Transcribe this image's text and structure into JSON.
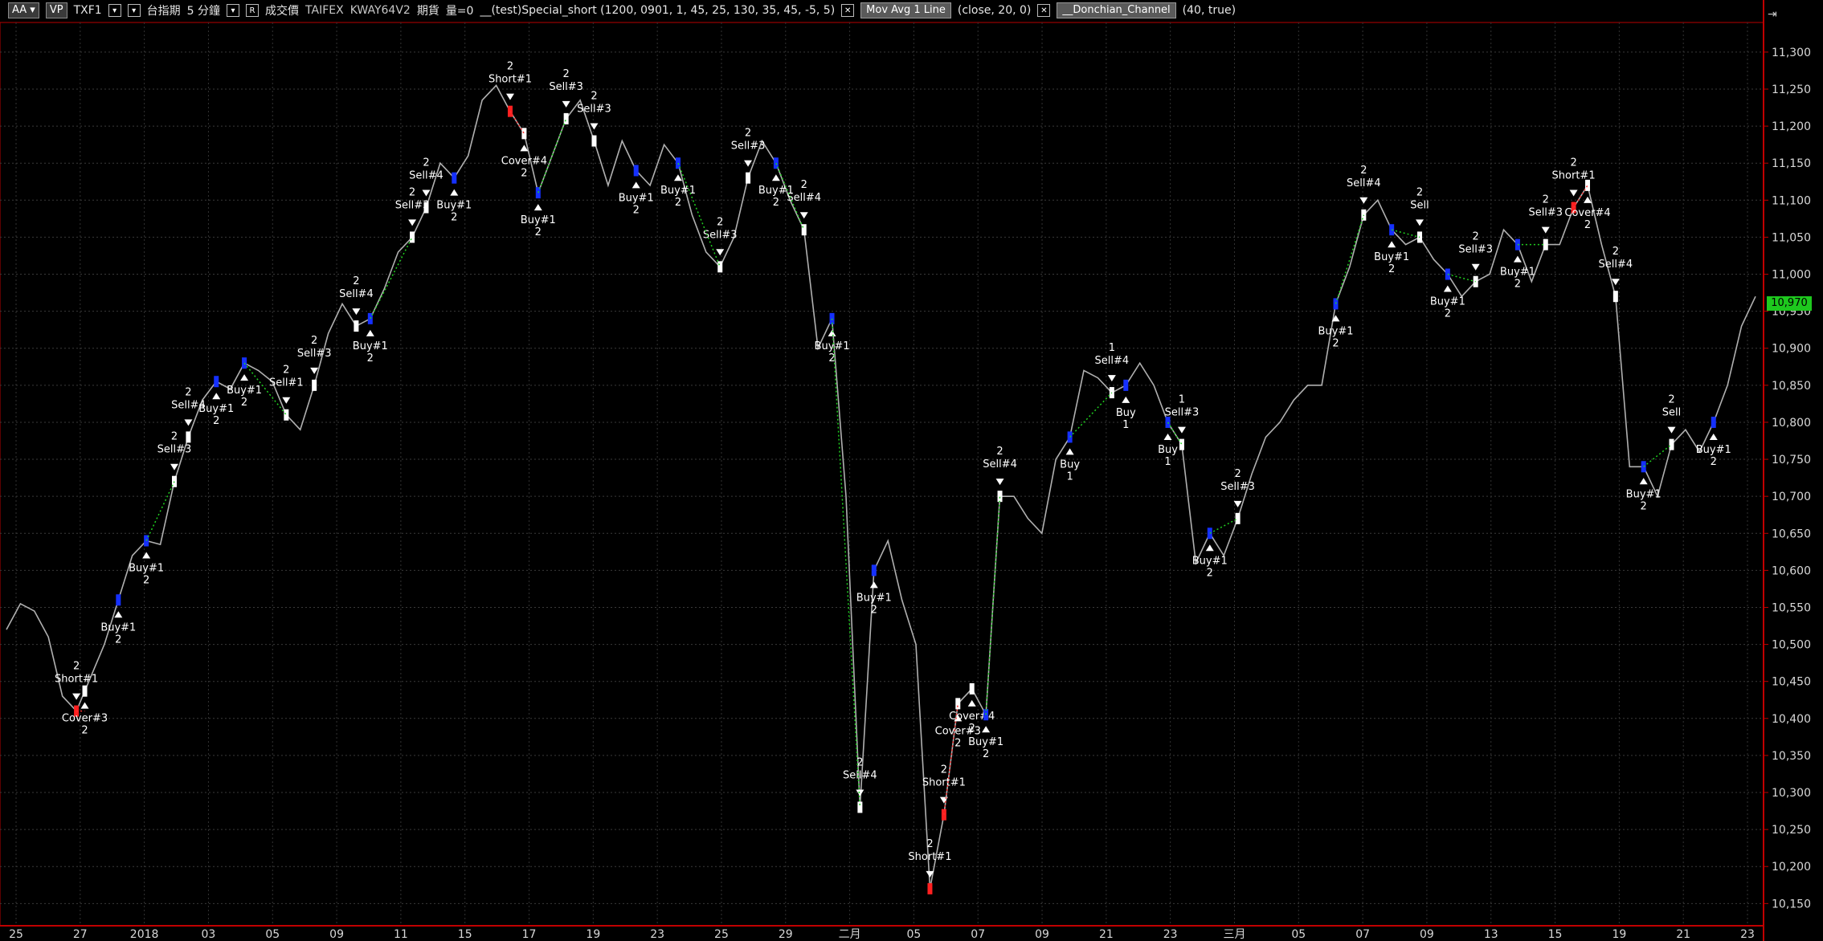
{
  "toolbar": {
    "aa": "AA",
    "vp": "VP",
    "symbol": "TXF1",
    "period": "台指期",
    "interval": "5 分鐘",
    "r": "R",
    "price_type": "成交價",
    "exchange": "TAIFEX",
    "account": "KWAY64V2",
    "kind": "期貨",
    "volume": "量=0",
    "strategy": "__(test)Special_short (1200, 0901, 1, 45, 25, 130, 35, 45, -5, 5)",
    "ma_label": "Mov Avg 1 Line",
    "ma_params": "(close, 20, 0)",
    "dc_label": "__Donchian_Channel",
    "dc_params": "(40, true)"
  },
  "last_price": "10,970",
  "chart_data": {
    "type": "line",
    "ylim": [
      10120,
      11340
    ],
    "y_ticks": [
      "11,300",
      "11,250",
      "11,200",
      "11,150",
      "11,100",
      "11,050",
      "11,000",
      "10,950",
      "10,900",
      "10,850",
      "10,800",
      "10,750",
      "10,700",
      "10,650",
      "10,600",
      "10,550",
      "10,500",
      "10,450",
      "10,400",
      "10,350",
      "10,300",
      "10,250",
      "10,200",
      "10,150"
    ],
    "x_ticks": [
      "25",
      "27",
      "2018",
      "03",
      "05",
      "09",
      "11",
      "15",
      "17",
      "19",
      "23",
      "25",
      "29",
      "二月",
      "05",
      "07",
      "09",
      "21",
      "23",
      "三月",
      "05",
      "07",
      "09",
      "13",
      "15",
      "19",
      "21",
      "23"
    ],
    "series": [
      {
        "x": [
          0,
          1,
          2,
          3,
          4,
          5,
          6,
          7,
          8,
          9,
          10,
          11,
          12,
          13,
          14,
          15,
          16,
          17,
          18,
          19,
          20,
          21,
          22,
          23,
          24,
          25,
          26,
          27,
          28,
          29,
          30,
          31,
          32,
          33,
          34,
          35,
          36,
          37,
          38,
          39,
          40,
          41,
          42,
          43,
          44,
          45,
          46,
          47,
          48,
          49,
          50,
          51,
          52,
          53,
          54,
          55,
          56,
          57,
          58,
          59,
          60,
          61,
          62,
          63,
          64,
          65,
          66,
          67,
          68,
          69,
          70,
          71,
          72,
          73,
          74,
          75,
          76,
          77,
          78,
          79,
          80,
          81,
          82,
          83,
          84,
          85,
          86,
          87,
          88,
          89,
          90,
          91,
          92,
          93,
          94,
          95,
          96,
          97,
          98,
          99,
          100,
          101,
          102,
          103,
          104,
          105,
          106,
          107,
          108,
          109,
          110,
          111,
          112,
          113,
          114,
          115,
          116,
          117,
          118,
          119,
          120,
          121,
          122,
          123,
          124,
          125
        ],
        "values": [
          10520,
          10555,
          10545,
          10510,
          10430,
          10410,
          10455,
          10500,
          10560,
          10620,
          10640,
          10635,
          10720,
          10780,
          10830,
          10855,
          10845,
          10880,
          10870,
          10855,
          10810,
          10790,
          10850,
          10920,
          10960,
          10930,
          10940,
          10980,
          11030,
          11050,
          11090,
          11150,
          11130,
          11160,
          11235,
          11255,
          11220,
          11190,
          11110,
          11160,
          11210,
          11235,
          11180,
          11120,
          11180,
          11140,
          11120,
          11175,
          11150,
          11080,
          11030,
          11010,
          11050,
          11130,
          11180,
          11150,
          11100,
          11060,
          10900,
          10940,
          10700,
          10280,
          10600,
          10640,
          10560,
          10500,
          10170,
          10270,
          10420,
          10440,
          10405,
          10700,
          10700,
          10670,
          10650,
          10750,
          10780,
          10870,
          10860,
          10840,
          10850,
          10880,
          10850,
          10800,
          10770,
          10610,
          10650,
          10620,
          10670,
          10730,
          10780,
          10800,
          10830,
          10850,
          10850,
          10960,
          11010,
          11080,
          11100,
          11060,
          11040,
          11050,
          11020,
          11000,
          10970,
          10990,
          11000,
          11060,
          11040,
          10990,
          11040,
          11040,
          11090,
          11120,
          11040,
          10970,
          10740,
          10740,
          10700,
          10770,
          10790,
          10760,
          10800,
          10850,
          10930,
          10970
        ],
        "name": ""
      }
    ],
    "signals": [
      {
        "x": 5,
        "side": "short",
        "label": "Short#1",
        "qty": "2"
      },
      {
        "x": 5.6,
        "side": "cover",
        "label": "Cover#3",
        "qty": "2"
      },
      {
        "x": 8,
        "side": "buy",
        "label": "Buy#1",
        "qty": "2"
      },
      {
        "x": 10,
        "side": "buy",
        "label": "Buy#1",
        "qty": "2"
      },
      {
        "x": 12,
        "side": "sell",
        "label": "Sell#3",
        "qty": "2"
      },
      {
        "x": 13,
        "side": "sell",
        "label": "Sell#4",
        "qty": "2"
      },
      {
        "x": 15,
        "side": "buy",
        "label": "Buy#1",
        "qty": "2"
      },
      {
        "x": 17,
        "side": "buy",
        "label": "Buy#1",
        "qty": "2"
      },
      {
        "x": 20,
        "side": "sell",
        "label": "Sell#1",
        "qty": "2"
      },
      {
        "x": 22,
        "side": "sell",
        "label": "Sell#3",
        "qty": "2"
      },
      {
        "x": 25,
        "side": "sell",
        "label": "Sell#4",
        "qty": "2"
      },
      {
        "x": 26,
        "side": "buy",
        "label": "Buy#1",
        "qty": "2"
      },
      {
        "x": 29,
        "side": "sell",
        "label": "Sell#3",
        "qty": "2"
      },
      {
        "x": 30,
        "side": "sell",
        "label": "Sell#4",
        "qty": "2"
      },
      {
        "x": 32,
        "side": "buy",
        "label": "Buy#1",
        "qty": "2"
      },
      {
        "x": 36,
        "side": "short",
        "label": "Short#1",
        "qty": "2"
      },
      {
        "x": 37,
        "side": "cover",
        "label": "Cover#4",
        "qty": "2"
      },
      {
        "x": 38,
        "side": "buy",
        "label": "Buy#1",
        "qty": "2"
      },
      {
        "x": 40,
        "side": "sell",
        "label": "Sell#3",
        "qty": "2"
      },
      {
        "x": 42,
        "side": "sell",
        "label": "Sell#3",
        "qty": "2"
      },
      {
        "x": 45,
        "side": "buy",
        "label": "Buy#1",
        "qty": "2"
      },
      {
        "x": 48,
        "side": "buy",
        "label": "Buy#1",
        "qty": "2"
      },
      {
        "x": 51,
        "side": "sell",
        "label": "Sell#3",
        "qty": "2"
      },
      {
        "x": 53,
        "side": "sell",
        "label": "Sell#3",
        "qty": "2"
      },
      {
        "x": 55,
        "side": "buy",
        "label": "Buy#1",
        "qty": "2"
      },
      {
        "x": 57,
        "side": "sell",
        "label": "Sell#4",
        "qty": "2"
      },
      {
        "x": 59,
        "side": "buy",
        "label": "Buy#1",
        "qty": "2"
      },
      {
        "x": 61,
        "side": "sell",
        "label": "Sell#4",
        "qty": "2"
      },
      {
        "x": 62,
        "side": "buy",
        "label": "Buy#1",
        "qty": "2"
      },
      {
        "x": 66,
        "side": "short",
        "label": "Short#1",
        "qty": "2"
      },
      {
        "x": 67,
        "side": "short",
        "label": "Short#1",
        "qty": "2"
      },
      {
        "x": 68,
        "side": "cover",
        "label": "Cover#3",
        "qty": "2"
      },
      {
        "x": 69,
        "side": "cover",
        "label": "Cover#4",
        "qty": "2"
      },
      {
        "x": 70,
        "side": "buy",
        "label": "Buy#1",
        "qty": "2"
      },
      {
        "x": 71,
        "side": "sell",
        "label": "Sell#4",
        "qty": "2"
      },
      {
        "x": 76,
        "side": "buy",
        "label": "Buy",
        "qty": "1"
      },
      {
        "x": 79,
        "side": "sell",
        "label": "Sell#4",
        "qty": "1"
      },
      {
        "x": 80,
        "side": "buy",
        "label": "Buy",
        "qty": "1"
      },
      {
        "x": 83,
        "side": "buy",
        "label": "Buy",
        "qty": "1"
      },
      {
        "x": 84,
        "side": "sell",
        "label": "Sell#3",
        "qty": "1"
      },
      {
        "x": 86,
        "side": "buy",
        "label": "Buy#1",
        "qty": "2"
      },
      {
        "x": 88,
        "side": "sell",
        "label": "Sell#3",
        "qty": "2"
      },
      {
        "x": 95,
        "side": "buy",
        "label": "Buy#1",
        "qty": "2"
      },
      {
        "x": 97,
        "side": "sell",
        "label": "Sell#4",
        "qty": "2"
      },
      {
        "x": 99,
        "side": "buy",
        "label": "Buy#1",
        "qty": "2"
      },
      {
        "x": 101,
        "side": "sell",
        "label": "Sell",
        "qty": "2"
      },
      {
        "x": 103,
        "side": "buy",
        "label": "Buy#1",
        "qty": "2"
      },
      {
        "x": 105,
        "side": "sell",
        "label": "Sell#3",
        "qty": "2"
      },
      {
        "x": 108,
        "side": "buy",
        "label": "Buy#1",
        "qty": "2"
      },
      {
        "x": 110,
        "side": "sell",
        "label": "Sell#3",
        "qty": "2"
      },
      {
        "x": 112,
        "side": "short",
        "label": "Short#1",
        "qty": "2"
      },
      {
        "x": 113,
        "side": "cover",
        "label": "Cover#4",
        "qty": "2"
      },
      {
        "x": 115,
        "side": "sell",
        "label": "Sell#4",
        "qty": "2"
      },
      {
        "x": 117,
        "side": "buy",
        "label": "Buy#1",
        "qty": "2"
      },
      {
        "x": 119,
        "side": "sell",
        "label": "Sell",
        "qty": "2"
      },
      {
        "x": 122,
        "side": "buy",
        "label": "Buy#1",
        "qty": "2"
      }
    ]
  }
}
